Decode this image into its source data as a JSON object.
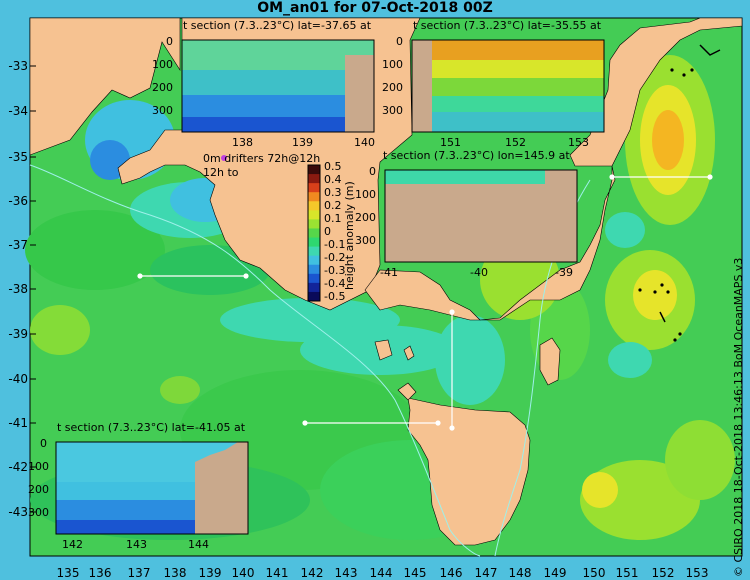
{
  "title": "OM_an01 for 07-Oct-2018 00Z",
  "credit": "© CSIRO 2018  18-Oct-2018 13:46:13 BoM OceanMAPS v3",
  "lat_ticks": [
    "-33",
    "-34",
    "-35",
    "-36",
    "-37",
    "-38",
    "-39",
    "-40",
    "-41",
    "-42",
    "-43"
  ],
  "lon_ticks": [
    "135",
    "136",
    "137",
    "138",
    "139",
    "140",
    "141",
    "142",
    "143",
    "144",
    "145",
    "146",
    "147",
    "148",
    "149",
    "150",
    "151",
    "152",
    "153"
  ],
  "drifters": {
    "line1": "0m   drifters 72h@12h",
    "line2": "12h to"
  },
  "colorbar": {
    "label": "height anomaly (m)",
    "ticks": [
      "0.5",
      "0.4",
      "0.3",
      "0.2",
      "0.1",
      "0",
      "-0.1",
      "-0.2",
      "-0.3",
      "-0.4",
      "-0.5"
    ],
    "colors": [
      "#3a0a0a",
      "#8a1a10",
      "#d8401a",
      "#f08a20",
      "#f5c82a",
      "#d8e62a",
      "#9be232",
      "#56d64a",
      "#2ed870",
      "#3ed8b0",
      "#40c0e0",
      "#2b8de0",
      "#1a55d0",
      "#12249a",
      "#0a0a5a"
    ]
  },
  "insets": [
    {
      "title": "t section (7.3..23°C) lat=-37.65 at",
      "yticks": [
        "0",
        "100",
        "200",
        "300"
      ],
      "xticks": [
        "138",
        "139",
        "140"
      ]
    },
    {
      "title": "t section (7.3..23°C) lat=-35.55 at",
      "yticks": [
        "0",
        "100",
        "200",
        "300"
      ],
      "xticks": [
        "151",
        "152",
        "153"
      ]
    },
    {
      "title": "t section (7.3..23°C) lon=145.9 at",
      "yticks": [
        "0",
        "100",
        "200",
        "300"
      ],
      "xticks": [
        "-41",
        "-40",
        "-39"
      ]
    },
    {
      "title": "t section (7.3..23°C) lat=-41.05 at",
      "yticks": [
        "0",
        "100",
        "200",
        "300"
      ],
      "xticks": [
        "142",
        "143",
        "144"
      ]
    }
  ]
}
